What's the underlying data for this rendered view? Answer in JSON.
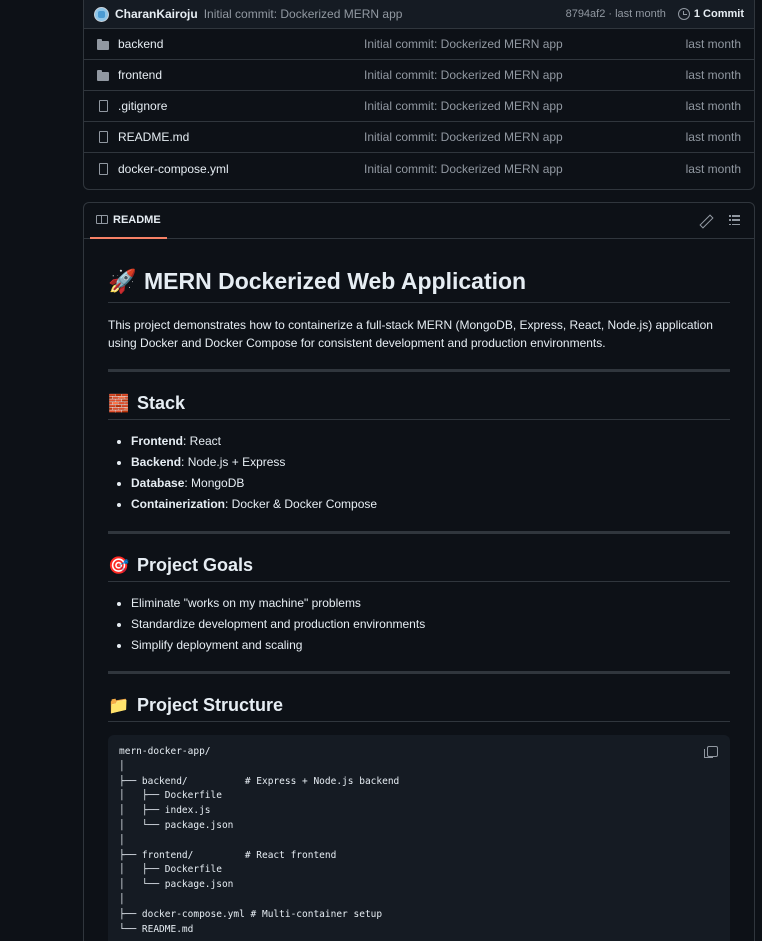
{
  "commit": {
    "author": "CharanKairoju",
    "message": "Initial commit: Dockerized MERN app",
    "meta": "8794af2 · last month",
    "count_label": "1 Commit"
  },
  "files": [
    {
      "name": "backend",
      "type": "folder",
      "message": "Initial commit: Dockerized MERN app",
      "time": "last month"
    },
    {
      "name": "frontend",
      "type": "folder",
      "message": "Initial commit: Dockerized MERN app",
      "time": "last month"
    },
    {
      "name": ".gitignore",
      "type": "file",
      "message": "Initial commit: Dockerized MERN app",
      "time": "last month"
    },
    {
      "name": "README.md",
      "type": "file",
      "message": "Initial commit: Dockerized MERN app",
      "time": "last month"
    },
    {
      "name": "docker-compose.yml",
      "type": "file",
      "message": "Initial commit: Dockerized MERN app",
      "time": "last month"
    }
  ],
  "readme": {
    "tab_label": "README",
    "title_emoji": "🚀",
    "title": "MERN Dockerized Web Application",
    "intro": "This project demonstrates how to containerize a full-stack MERN (MongoDB, Express, React, Node.js) application using Docker and Docker Compose for consistent development and production environments.",
    "stack": {
      "emoji": "🧱",
      "heading": "Stack",
      "items": [
        {
          "label": "Frontend",
          "value": ": React"
        },
        {
          "label": "Backend",
          "value": ": Node.js + Express"
        },
        {
          "label": "Database",
          "value": ": MongoDB"
        },
        {
          "label": "Containerization",
          "value": ": Docker & Docker Compose"
        }
      ]
    },
    "goals": {
      "emoji": "🎯",
      "heading": "Project Goals",
      "items": [
        "Eliminate \"works on my machine\" problems",
        "Standardize development and production environments",
        "Simplify deployment and scaling"
      ]
    },
    "structure": {
      "emoji": "📁",
      "heading": "Project Structure",
      "code": "mern-docker-app/\n│\n├── backend/          # Express + Node.js backend\n│   ├── Dockerfile\n│   ├── index.js\n│   └── package.json\n│\n├── frontend/         # React frontend\n│   ├── Dockerfile\n│   └── package.json\n│\n├── docker-compose.yml # Multi-container setup\n└── README.md"
    }
  },
  "colors": {
    "background": "#0d1117",
    "border": "#30363d",
    "muted_text": "#9198a1",
    "tab_underline": "#f78166"
  }
}
